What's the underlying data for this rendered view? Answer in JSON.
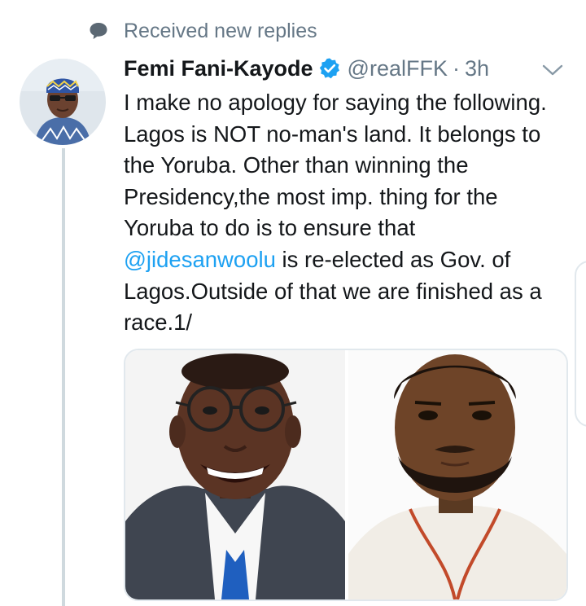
{
  "notice": {
    "icon": "chat-bubble-icon",
    "text": "Received new replies"
  },
  "tweet": {
    "author_name": "Femi Fani-Kayode",
    "verified_icon": "verified-badge-icon",
    "handle": "@realFFK",
    "separator": "·",
    "time": "3h",
    "menu_icon": "chevron-down-icon",
    "text_before_mention": "I make no apology for saying the following. Lagos is NOT no-man's land. It belongs to the Yoruba. Other than winning the Presidency,the most imp. thing for the Yoruba to do is to ensure that ",
    "mention": "@jidesanwoolu",
    "text_after_mention": " is re-elected as Gov. of Lagos.Outside of that we are finished as a race.1/"
  },
  "colors": {
    "link": "#1da1f2",
    "muted": "#657786",
    "text": "#14171a",
    "verified": "#1da1f2",
    "thread_line": "#cfd9de"
  }
}
